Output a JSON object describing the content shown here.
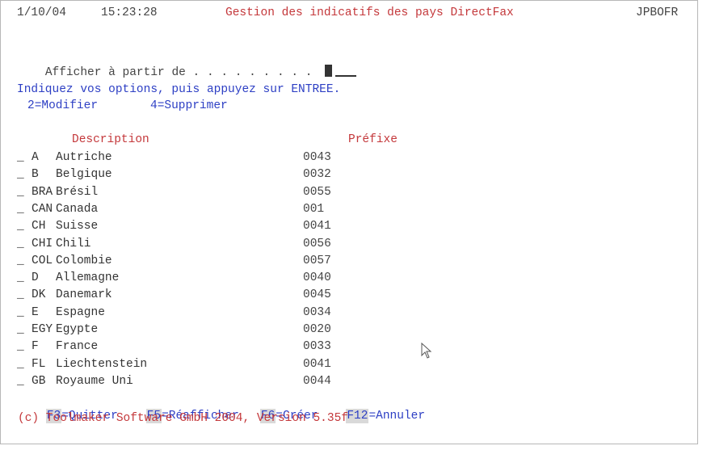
{
  "header": {
    "date": "1/10/04",
    "time": "15:23:28",
    "title": "Gestion des indicatifs des pays DirectFax",
    "program": "JPBOFR"
  },
  "position": {
    "label": "Afficher à partir de . . . . . . . . .",
    "value": ""
  },
  "instructions": {
    "text": "Indiquez vos options, puis appuyez sur ENTREE.",
    "options": [
      {
        "key": "2",
        "label": "2=Modifier"
      },
      {
        "key": "4",
        "label": "4=Supprimer"
      }
    ]
  },
  "table": {
    "col_description": "Description",
    "col_prefix": "Préfixe",
    "rows": [
      {
        "sel": "_",
        "code": "A",
        "description": "Autriche",
        "prefix": "0043"
      },
      {
        "sel": "_",
        "code": "B",
        "description": "Belgique",
        "prefix": "0032"
      },
      {
        "sel": "_",
        "code": "BRA",
        "description": "Brésil",
        "prefix": "0055"
      },
      {
        "sel": "_",
        "code": "CAN",
        "description": "Canada",
        "prefix": "001"
      },
      {
        "sel": "_",
        "code": "CH",
        "description": "Suisse",
        "prefix": "0041"
      },
      {
        "sel": "_",
        "code": "CHI",
        "description": "Chili",
        "prefix": "0056"
      },
      {
        "sel": "_",
        "code": "COL",
        "description": "Colombie",
        "prefix": "0057"
      },
      {
        "sel": "_",
        "code": "D",
        "description": "Allemagne",
        "prefix": "0040"
      },
      {
        "sel": "_",
        "code": "DK",
        "description": "Danemark",
        "prefix": "0045"
      },
      {
        "sel": "_",
        "code": "E",
        "description": "Espagne",
        "prefix": "0034"
      },
      {
        "sel": "_",
        "code": "EGY",
        "description": "Egypte",
        "prefix": "0020"
      },
      {
        "sel": "_",
        "code": "F",
        "description": "France",
        "prefix": "0033"
      },
      {
        "sel": "_",
        "code": "FL",
        "description": "Liechtenstein",
        "prefix": "0041"
      },
      {
        "sel": "_",
        "code": "GB",
        "description": "Royaume Uni",
        "prefix": "0044"
      }
    ]
  },
  "function_keys": [
    {
      "key": "F3",
      "label": "=Quitter"
    },
    {
      "key": "F5",
      "label": "=Réafficher"
    },
    {
      "key": "F6",
      "label": "=Créer"
    },
    {
      "key": "F12",
      "label": "=Annuler"
    }
  ],
  "footer": {
    "copyright": "(c) Toolmaker Software GmbH 2004, Version 5.35f"
  },
  "colors": {
    "red": "#c4383b",
    "blue": "#2d3fc4",
    "fkey_bg": "#d9d9d9"
  },
  "icons": {
    "mouse": "mouse-pointer-icon"
  }
}
